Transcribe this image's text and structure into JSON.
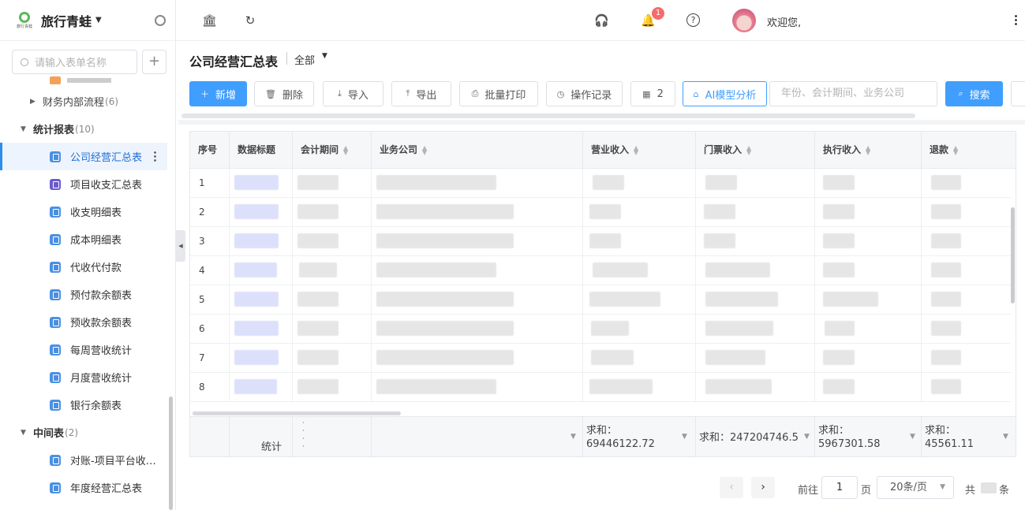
{
  "brand": {
    "name": "旅行青蛙",
    "logo_caption": "旅行青蛙"
  },
  "sidebar": {
    "search_placeholder": "请输入表单名称",
    "groups": [
      {
        "label": "财务内部流程",
        "count": "(6)"
      },
      {
        "label": "统计报表",
        "count": "(10)"
      },
      {
        "label": "中间表",
        "count": "(2)"
      }
    ],
    "report_items": [
      {
        "label": "公司经营汇总表",
        "active": true
      },
      {
        "label": "项目收支汇总表"
      },
      {
        "label": "收支明细表"
      },
      {
        "label": "成本明细表"
      },
      {
        "label": "代收代付款"
      },
      {
        "label": "预付款余额表"
      },
      {
        "label": "预收款余额表"
      },
      {
        "label": "每周营收统计"
      },
      {
        "label": "月度营收统计"
      },
      {
        "label": "银行余额表"
      }
    ],
    "middle_items": [
      {
        "label": "对账-项目平台收款明细"
      },
      {
        "label": "年度经营汇总表"
      }
    ]
  },
  "topbar": {
    "notification_count": "1",
    "welcome": "欢迎您,"
  },
  "page": {
    "title": "公司经营汇总表",
    "scope": "全部"
  },
  "toolbar": {
    "add": "新增",
    "delete": "删除",
    "import": "导入",
    "export": "导出",
    "batch_print": "批量打印",
    "history": "操作记录",
    "view_count": "2",
    "ai": "AI模型分析",
    "filter_placeholder": "年份、会计期间、业务公司",
    "search": "搜索"
  },
  "table": {
    "columns": [
      "序号",
      "数据标题",
      "会计期间",
      "业务公司",
      "营业收入",
      "门票收入",
      "执行收入",
      "退款"
    ],
    "rows": [
      "1",
      "2",
      "3",
      "4",
      "5",
      "6",
      "7",
      "8"
    ],
    "footer": {
      "label": "统计",
      "dots": "· · · ·",
      "sum_revenue": "求和：",
      "sum_revenue_value": "69446122.72",
      "sum_ticket": "求和：247204746.5",
      "sum_exec": "求和：",
      "sum_exec_value": "5967301.58",
      "sum_refund": "求和：",
      "sum_refund_value": "45561.11"
    }
  },
  "pagination": {
    "goto": "前往",
    "page": "1",
    "page_unit": "页",
    "page_size": "20条/页",
    "total_prefix": "共",
    "total_suffix": "条"
  },
  "colors": {
    "primary": "#409eff",
    "active_bg": "#eef4fd",
    "badge": "#f56c6c"
  },
  "icons": [
    "bank-icon",
    "refresh-icon",
    "headset-icon",
    "bell-icon",
    "help-icon",
    "more-icon",
    "gear-icon",
    "search-icon",
    "plus-icon",
    "form-icon"
  ]
}
